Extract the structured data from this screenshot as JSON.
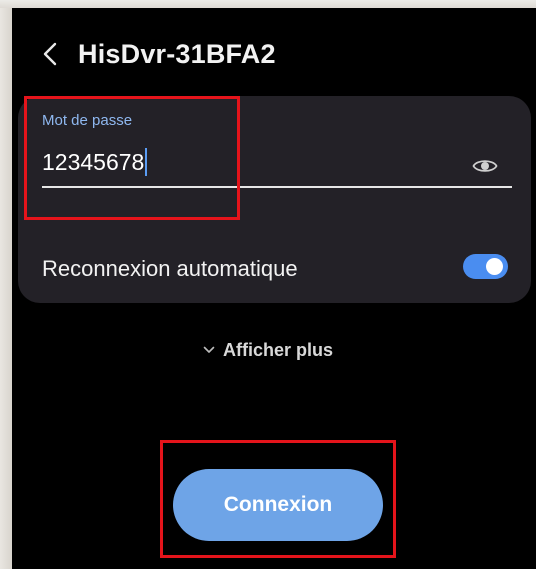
{
  "header": {
    "back_icon": "chevron-left-icon",
    "title": "HisDvr-31BFA2"
  },
  "password": {
    "label": "Mot de passe",
    "value": "12345678",
    "visibility_icon": "eye-icon"
  },
  "auto_reconnect": {
    "label": "Reconnexion automatique",
    "enabled": true
  },
  "show_more": {
    "icon": "chevron-down-icon",
    "label": "Afficher plus"
  },
  "connect": {
    "label": "Connexion"
  },
  "colors": {
    "background": "#000000",
    "card": "#232127",
    "accent_label": "#8fb8f0",
    "toggle_on": "#4a8df0",
    "button": "#6ea4e7",
    "highlight": "#e5141b"
  }
}
